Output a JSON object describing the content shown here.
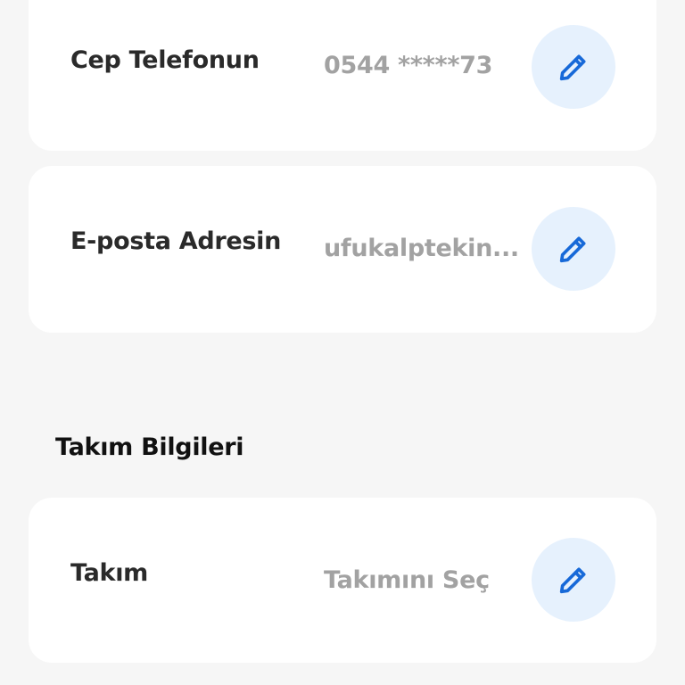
{
  "contact": {
    "phone": {
      "label": "Cep Telefonun",
      "value": "0544 *****73",
      "edit_icon": "pencil-icon"
    },
    "email": {
      "label": "E-posta Adresin",
      "value": "ufukalptekin...",
      "edit_icon": "pencil-icon"
    }
  },
  "team_section": {
    "title": "Takım Bilgileri",
    "team": {
      "label": "Takım",
      "value": "Takımını Seç",
      "edit_icon": "pencil-icon"
    }
  },
  "colors": {
    "background": "#f6f6f6",
    "card": "#ffffff",
    "label_text": "#2a2a2a",
    "value_text": "#a2a2a2",
    "edit_button_bg": "#e6f1fd",
    "accent_blue": "#1769d8"
  }
}
